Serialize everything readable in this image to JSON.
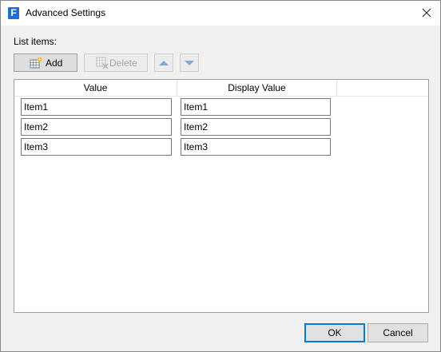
{
  "window": {
    "title": "Advanced Settings",
    "app_icon_letter": "F"
  },
  "list_label": "List items:",
  "toolbar": {
    "add_label": "Add",
    "delete_label": "Delete",
    "up_icon": "arrow-up-icon",
    "down_icon": "arrow-down-icon"
  },
  "grid": {
    "columns": [
      "Value",
      "Display Value"
    ],
    "rows": [
      {
        "value": "Item1",
        "display": "Item1"
      },
      {
        "value": "Item2",
        "display": "Item2"
      },
      {
        "value": "Item3",
        "display": "Item3"
      }
    ]
  },
  "buttons": {
    "ok": "OK",
    "cancel": "Cancel"
  },
  "colors": {
    "accent": "#0078d7",
    "app_icon": "#1d6fd8"
  }
}
